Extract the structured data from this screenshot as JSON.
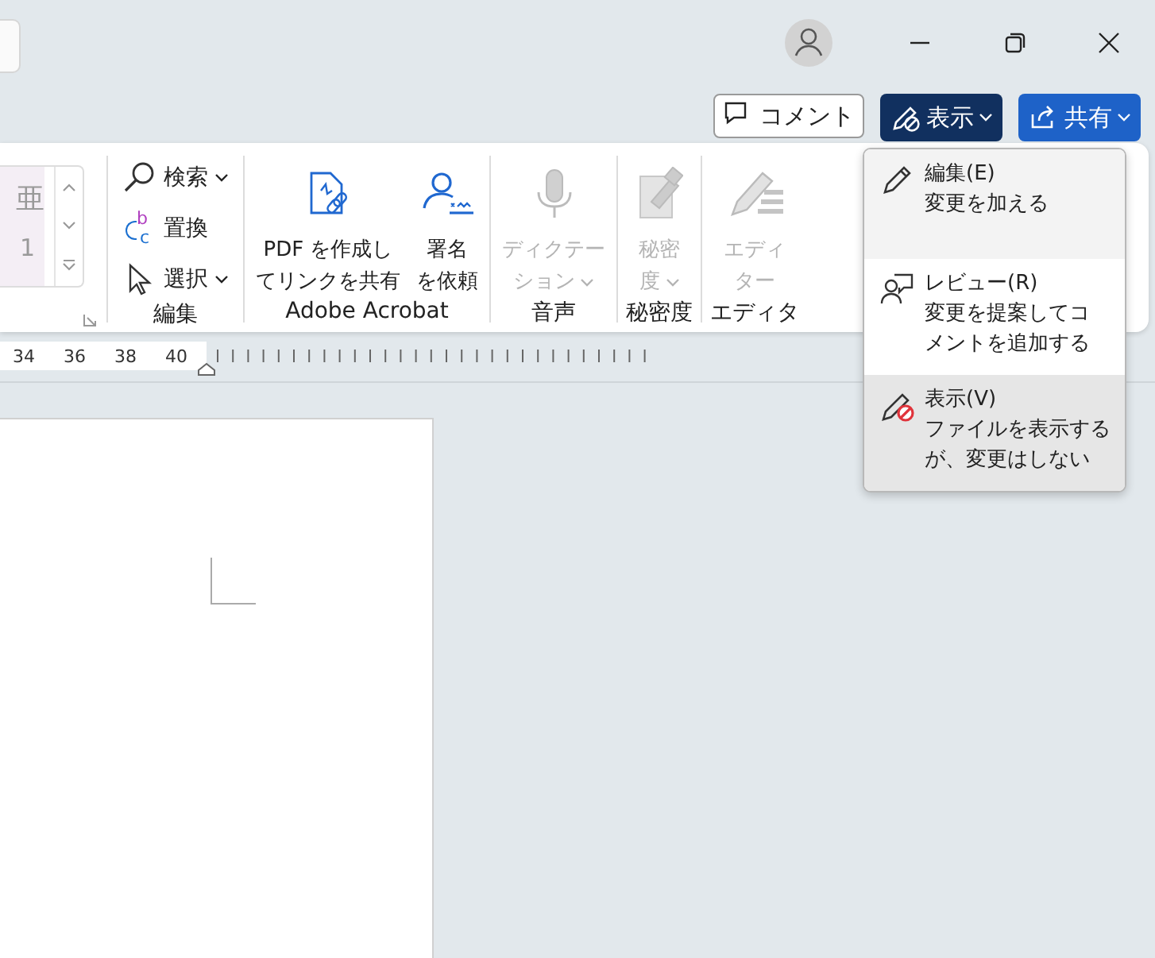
{
  "title_bar": {
    "controls": [
      {
        "kind": "minimize"
      },
      {
        "kind": "restore"
      },
      {
        "kind": "close"
      }
    ]
  },
  "actions": [
    {
      "kind": "comment",
      "label": "コメント",
      "dropdown": false
    },
    {
      "kind": "view",
      "label": "表示",
      "dropdown": true
    },
    {
      "kind": "share",
      "label": "共有",
      "dropdown": true
    }
  ],
  "ribbon": {
    "gallery": {
      "sample": "亜",
      "number": "1"
    },
    "groups": [
      {
        "label": "編集",
        "kind": "list",
        "items": [
          {
            "kind": "search",
            "label": "検索",
            "dropdown": true
          },
          {
            "kind": "replace",
            "icon_text": [
              "b",
              "c"
            ],
            "label": "置換",
            "dropdown": false
          },
          {
            "kind": "select",
            "label": "選択",
            "dropdown": true
          }
        ]
      },
      {
        "label": "Adobe Acrobat",
        "kind": "large",
        "items": [
          {
            "kind": "pdf",
            "lines": [
              "PDF を作成し",
              "てリンクを共有"
            ],
            "dropdown": false,
            "disabled": false
          },
          {
            "kind": "sign",
            "lines": [
              "署名",
              "を依頼"
            ],
            "dropdown": false,
            "disabled": false
          }
        ]
      },
      {
        "label": "音声",
        "kind": "large",
        "items": [
          {
            "kind": "mic",
            "lines": [
              "ディクテー",
              "ション"
            ],
            "dropdown": true,
            "disabled": true
          }
        ]
      },
      {
        "label": "秘密度",
        "kind": "large",
        "items": [
          {
            "kind": "sensitivity",
            "lines": [
              "秘密",
              "度"
            ],
            "dropdown": true,
            "disabled": true
          }
        ]
      },
      {
        "label": "エディタ",
        "kind": "large",
        "items": [
          {
            "kind": "editor",
            "lines": [
              "エディ",
              "ター"
            ],
            "dropdown": false,
            "disabled": true
          }
        ]
      }
    ]
  },
  "ruler": {
    "labels": [
      "34",
      "36",
      "38",
      "40"
    ]
  },
  "mode_menu": {
    "items": [
      {
        "kind": "edit",
        "title": "編集(E)",
        "lines": [
          "変更を加える"
        ],
        "selected": false,
        "hovered": true
      },
      {
        "kind": "review",
        "title": "レビュー(R)",
        "lines": [
          "変更を提案してコ",
          "メントを追加する"
        ],
        "selected": false,
        "hovered": false
      },
      {
        "kind": "view",
        "title": "表示(V)",
        "lines": [
          "ファイルを表示する",
          "が、変更はしない"
        ],
        "selected": true,
        "hovered": false
      }
    ]
  }
}
